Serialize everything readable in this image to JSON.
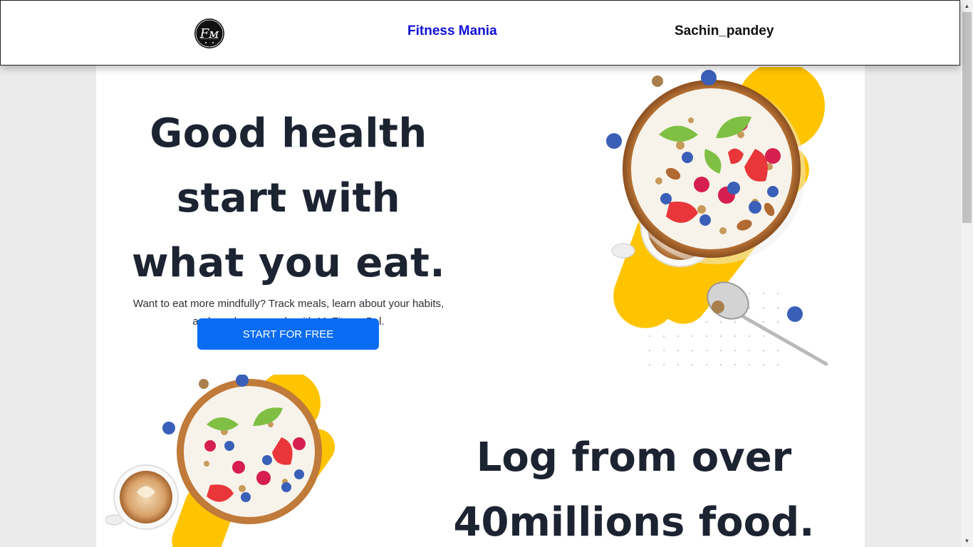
{
  "header": {
    "logo_icon": "fitness-logo-icon",
    "brand": "Fitness Mania",
    "username": "Sachin_pandey"
  },
  "hero": {
    "title_line1": "Good health",
    "title_line2": "start with",
    "title_line3": "what you eat.",
    "description": "Want to eat more mindfully? Track meals, learn about your habits, and reach your goals with MyFitnessPal.",
    "cta_label": "START FOR FREE",
    "image_icon": "breakfast-bowl-illustration"
  },
  "section2": {
    "title_line1": "Log from over",
    "title_line2": "40millions food.",
    "image_icon": "breakfast-bowl-illustration"
  },
  "colors": {
    "accent": "#0a6cf3",
    "brand_text": "#1010d8",
    "heading": "#1c2331",
    "yellow": "#ffc400"
  }
}
